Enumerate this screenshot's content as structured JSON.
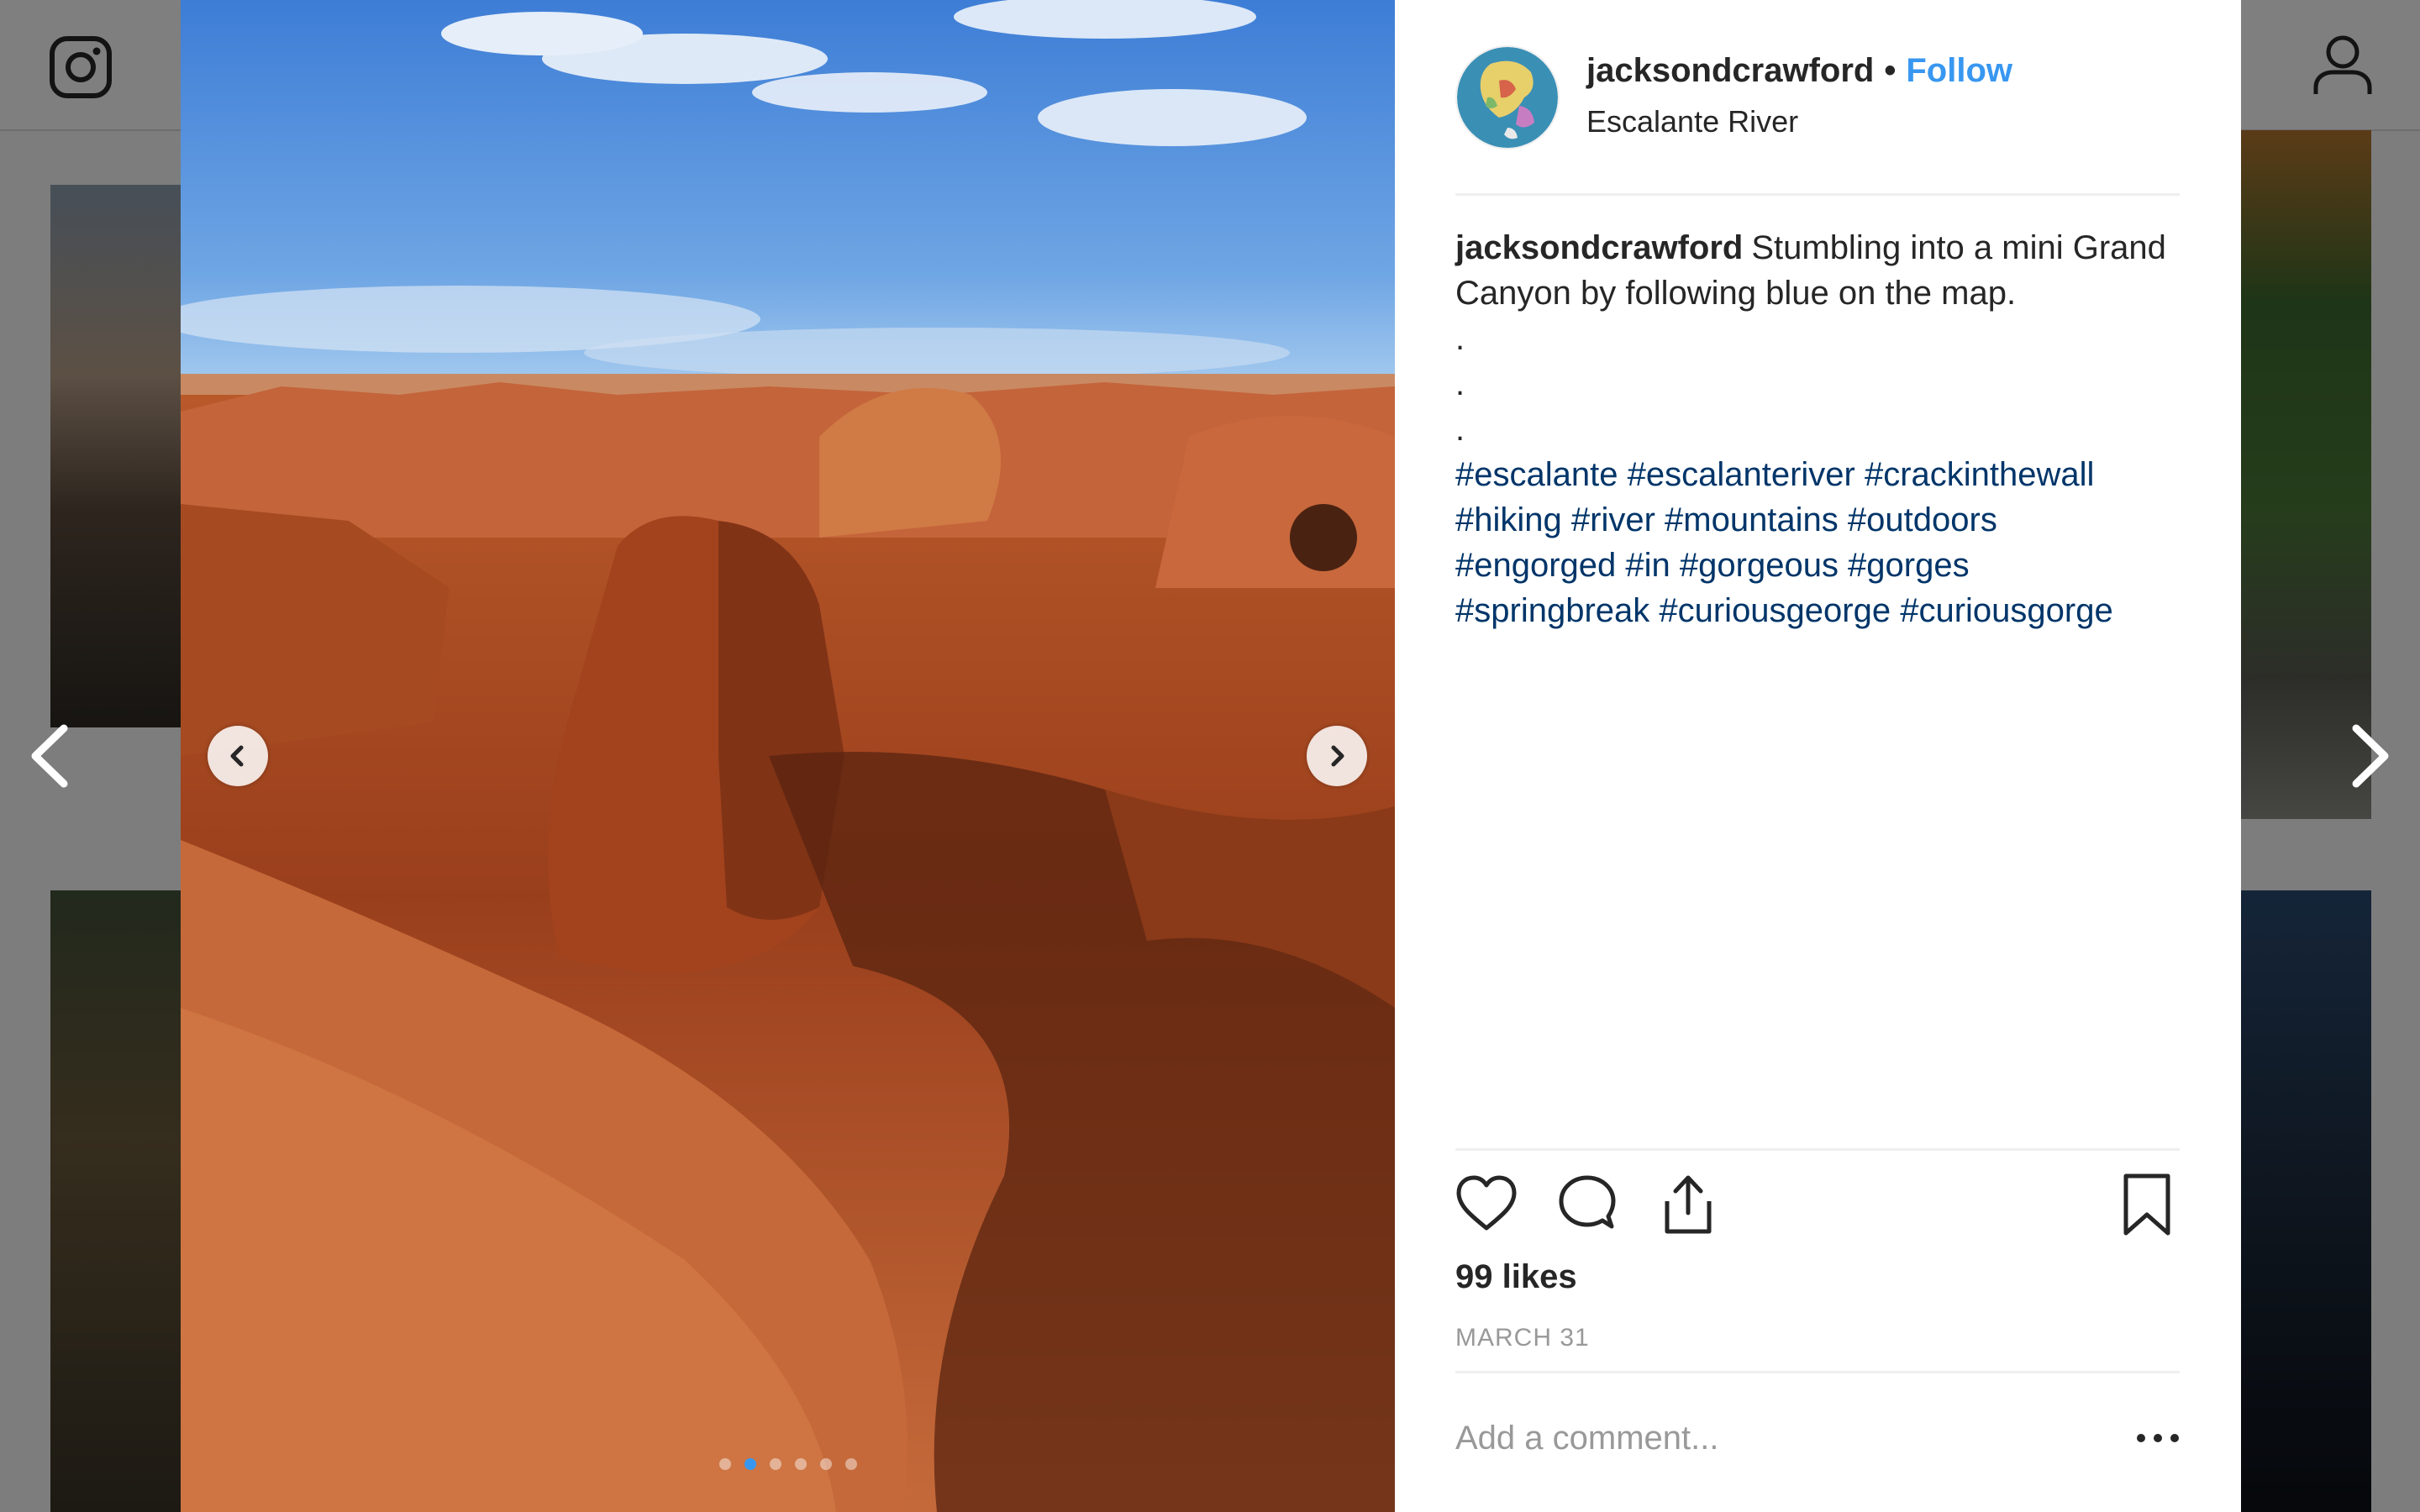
{
  "post": {
    "username": "jacksondcrawford",
    "separator": "•",
    "follow_label": "Follow",
    "location": "Escalante River",
    "caption_user": "jacksondcrawford",
    "caption_text": "Stumbling into a mini Grand Canyon by following blue on the map.",
    "caption_dots": [
      ".",
      ".",
      "."
    ],
    "hashtag_lines": [
      "#escalante #escalanteriver #crackinthewall",
      "#hiking #river #mountains #outdoors",
      "#engorged #in #gorgeous #gorges",
      "#springbreak #curiousgeorge #curiousgorge"
    ],
    "likes": "99 likes",
    "date": "MARCH 31",
    "comment_placeholder": "Add a comment...",
    "carousel": {
      "count": 6,
      "active_index": 1
    }
  },
  "colors": {
    "link_blue": "#3897f0",
    "hashtag": "#003569",
    "muted": "#999999"
  },
  "icons": {
    "logo": "instagram-logo-icon",
    "profile": "profile-icon",
    "like": "heart-icon",
    "comment": "comment-bubble-icon",
    "share": "share-icon",
    "save": "bookmark-icon",
    "more": "more-dots-icon",
    "prev": "chevron-left-icon",
    "next": "chevron-right-icon"
  }
}
